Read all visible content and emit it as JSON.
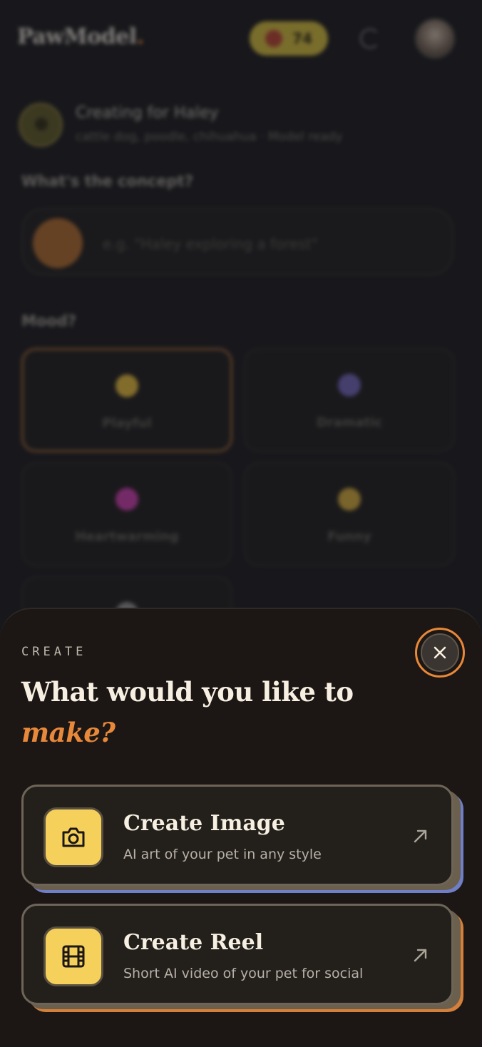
{
  "header": {
    "logo_text": "PawModel",
    "logo_dot": ".",
    "credits_count": "74"
  },
  "pet": {
    "title": "Creating for Haley",
    "subtitle": "cattle dog, poodle, chihuahua · Model ready"
  },
  "concept": {
    "label": "What's the concept?",
    "placeholder": "e.g. \"Haley exploring a forest\""
  },
  "mood": {
    "label": "Mood?",
    "options": [
      {
        "label": "Playful",
        "selected": true,
        "emoji_color": "#d9b23a"
      },
      {
        "label": "Dramatic",
        "selected": false,
        "emoji_color": "#6a5fb0"
      },
      {
        "label": "Heartwarming",
        "selected": false,
        "emoji_color": "#c23aa6"
      },
      {
        "label": "Funny",
        "selected": false,
        "emoji_color": "#c9a23a"
      },
      {
        "label": "",
        "selected": false,
        "emoji_color": "#8a8a8a"
      }
    ]
  },
  "sheet": {
    "eyebrow": "CREATE",
    "headline_main": "What would you like to",
    "headline_accent": "make?",
    "options": [
      {
        "title": "Create Image",
        "description": "AI art of your pet in any style",
        "icon": "camera-icon"
      },
      {
        "title": "Create Reel",
        "description": "Short AI video of your pet for social",
        "icon": "film-icon"
      }
    ]
  },
  "colors": {
    "accent": "#e8883a",
    "icon_bg": "#f5d05b",
    "sheet_bg": "#1c1714",
    "page_bg": "#18181c"
  }
}
